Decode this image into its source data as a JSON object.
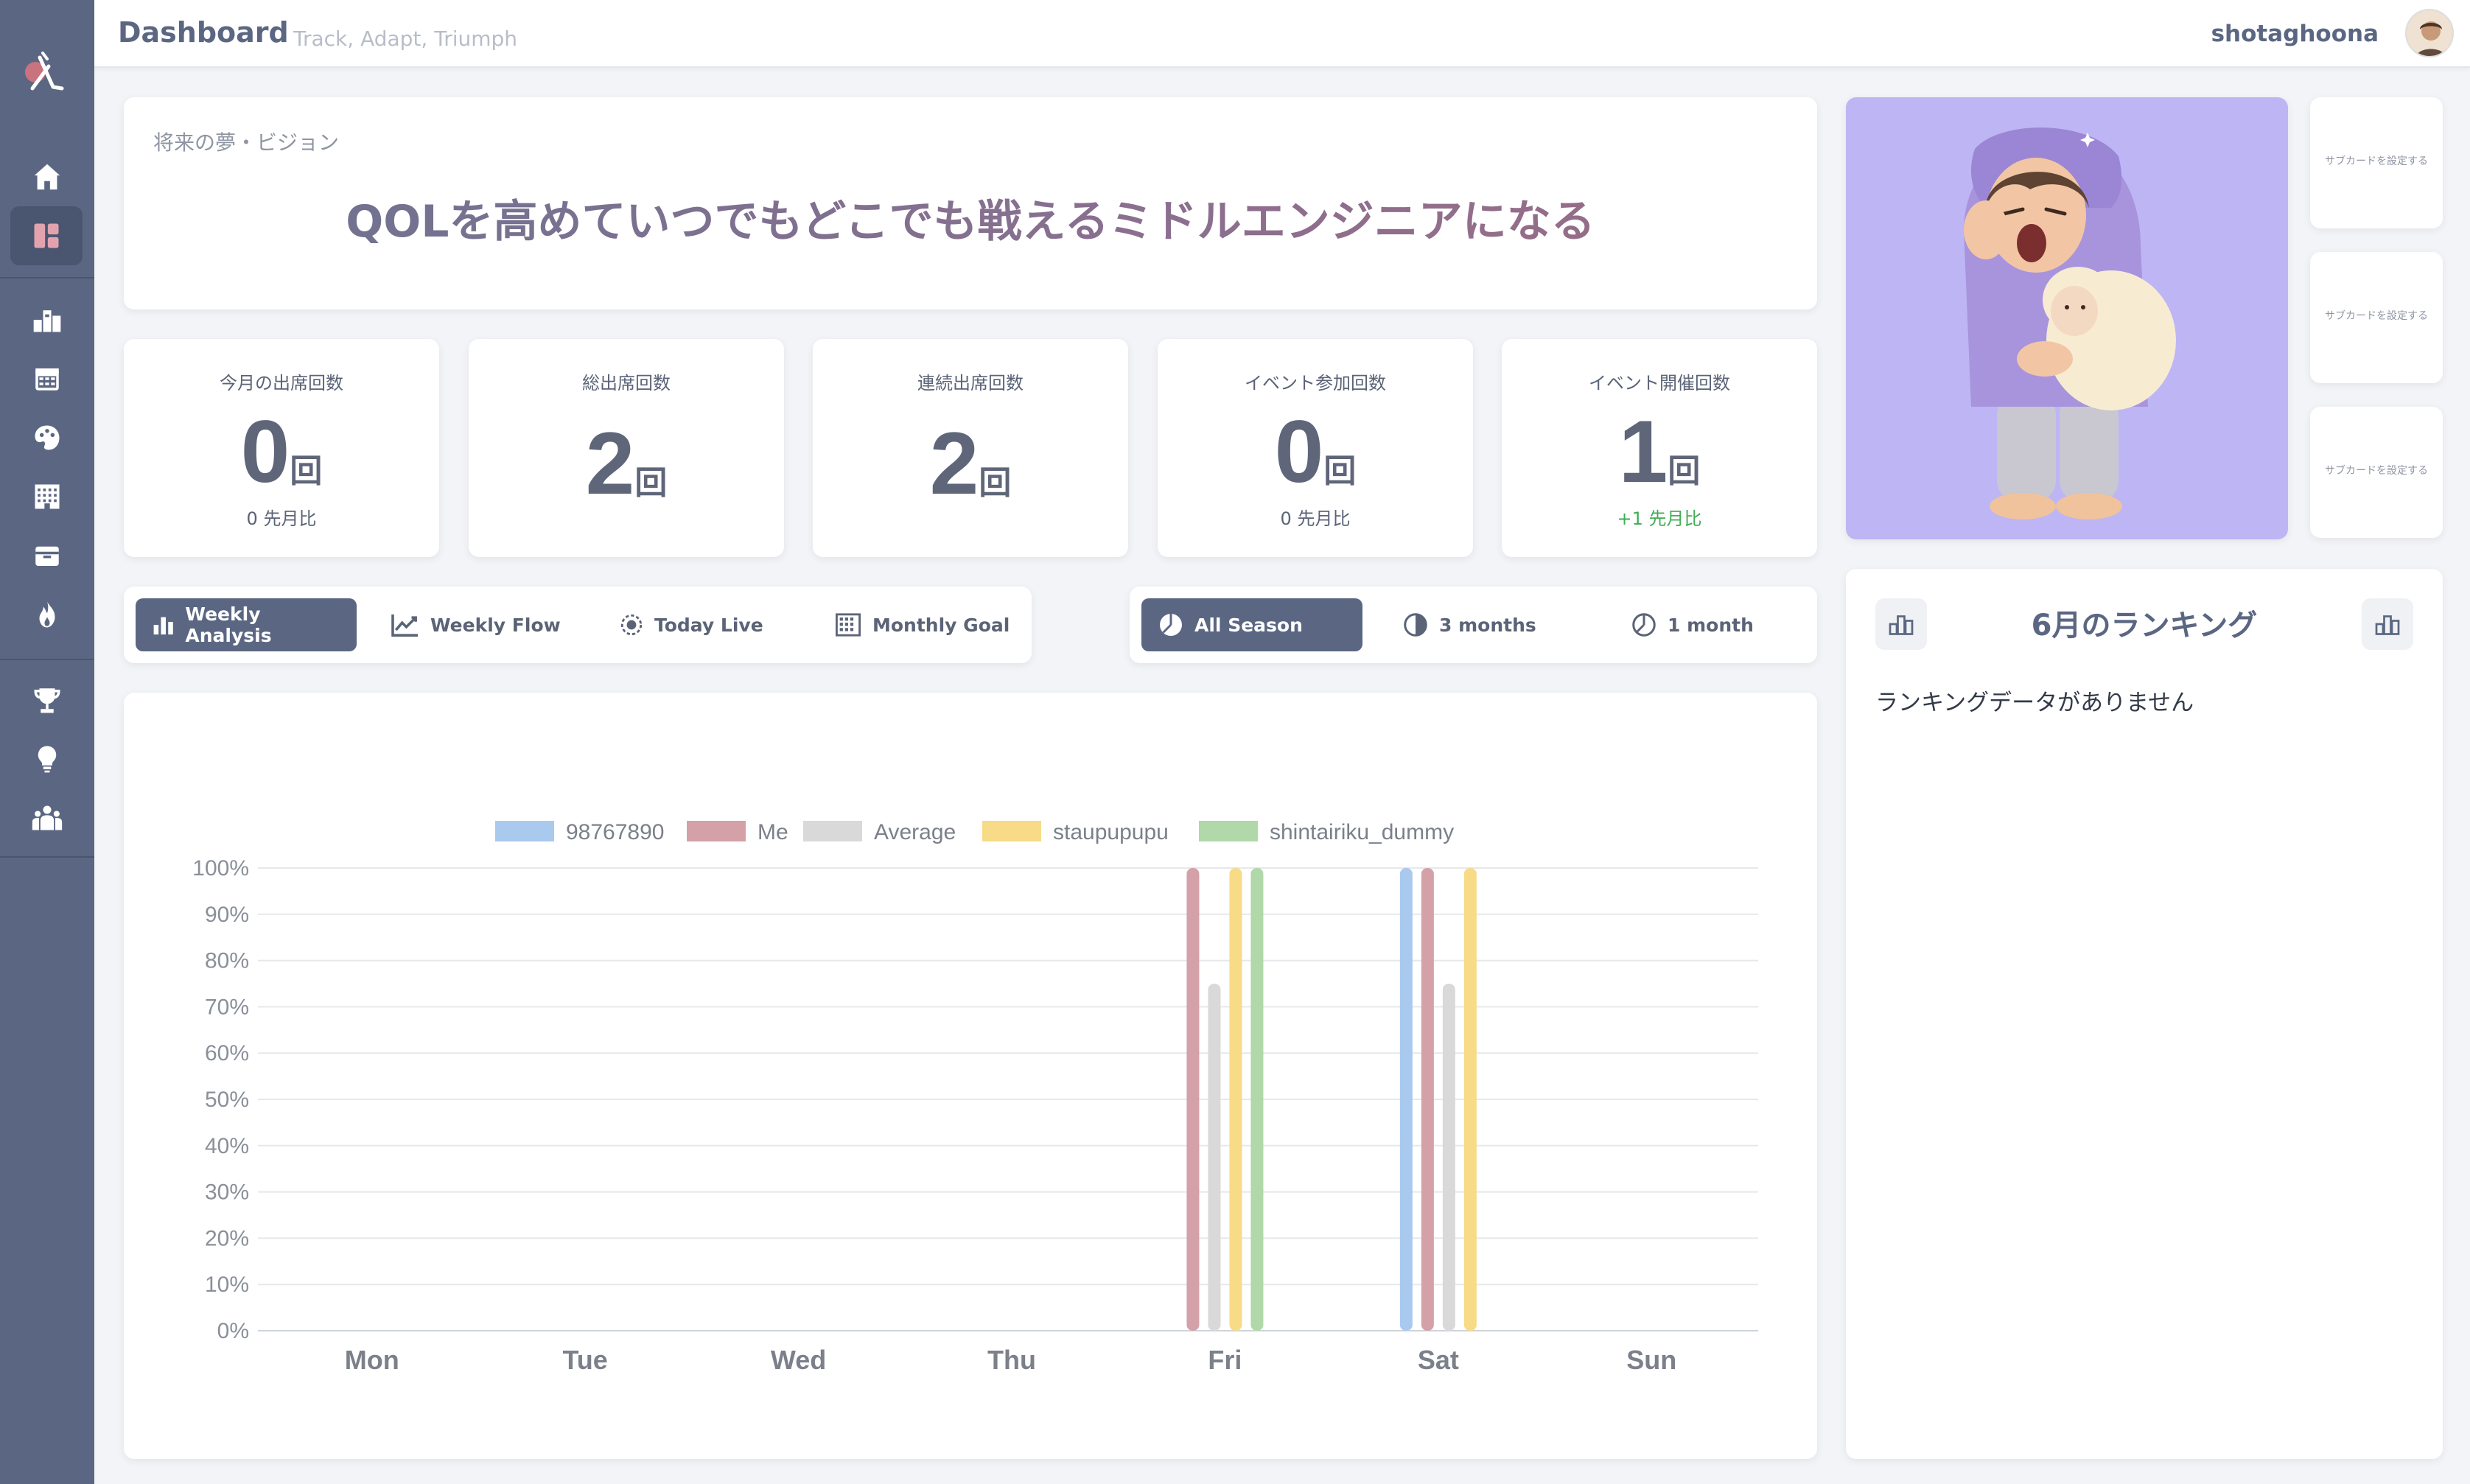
{
  "header": {
    "title": "Dashboard",
    "subtitle": "Track, Adapt, Triumph",
    "username": "shotaghoona"
  },
  "sidebar": {
    "items": [
      {
        "icon": "home-icon"
      },
      {
        "icon": "dashboard-icon",
        "active": true
      },
      {
        "icon": "ranking-icon"
      },
      {
        "icon": "calendar-icon"
      },
      {
        "icon": "palette-icon"
      },
      {
        "icon": "building-icon"
      },
      {
        "icon": "archive-icon"
      },
      {
        "icon": "fire-icon"
      },
      {
        "icon": "trophy-icon"
      },
      {
        "icon": "lightbulb-icon"
      },
      {
        "icon": "team-icon"
      }
    ]
  },
  "vision": {
    "label": "将来の夢・ビジョン",
    "text": "QOLを高めていつでもどこでも戦えるミドルエンジニアになる"
  },
  "stats": [
    {
      "title": "今月の出席回数",
      "value": "0",
      "unit": "回",
      "diff": "0 先月比"
    },
    {
      "title": "総出席回数",
      "value": "2",
      "unit": "回",
      "diff": ""
    },
    {
      "title": "連続出席回数",
      "value": "2",
      "unit": "回",
      "diff": ""
    },
    {
      "title": "イベント参加回数",
      "value": "0",
      "unit": "回",
      "diff": "0 先月比"
    },
    {
      "title": "イベント開催回数",
      "value": "1",
      "unit": "回",
      "diff": "+1 先月比"
    }
  ],
  "view_tabs": [
    {
      "label": "Weekly Analysis",
      "icon": "bar-chart-icon",
      "active": true
    },
    {
      "label": "Weekly Flow",
      "icon": "line-chart-icon",
      "active": false
    },
    {
      "label": "Today Live",
      "icon": "live-icon",
      "active": false
    },
    {
      "label": "Monthly Goal",
      "icon": "grid-icon",
      "active": false
    }
  ],
  "range_tabs": [
    {
      "label": "All Season",
      "icon": "pie-full-icon",
      "active": true
    },
    {
      "label": "3 months",
      "icon": "pie-half-icon",
      "active": false
    },
    {
      "label": "1 month",
      "icon": "pie-quarter-icon",
      "active": false
    }
  ],
  "ranking": {
    "title": "6月のランキング",
    "empty": "ランキングデータがありません"
  },
  "subcards": [
    "サブカードを設定する",
    "サブカードを設定する",
    "サブカードを設定する"
  ],
  "chart_data": {
    "type": "bar",
    "categories": [
      "Mon",
      "Tue",
      "Wed",
      "Thu",
      "Fri",
      "Sat",
      "Sun"
    ],
    "ylim": [
      0,
      100
    ],
    "yticks": [
      "0%",
      "10%",
      "20%",
      "30%",
      "40%",
      "50%",
      "60%",
      "70%",
      "80%",
      "90%",
      "100%"
    ],
    "grid": true,
    "legend": "top",
    "series": [
      {
        "name": "98767890",
        "color": "#a9c9ef",
        "values": [
          0,
          0,
          0,
          0,
          0,
          100,
          0
        ]
      },
      {
        "name": "Me",
        "color": "#d4a1a8",
        "values": [
          0,
          0,
          0,
          0,
          100,
          100,
          0
        ]
      },
      {
        "name": "Average",
        "color": "#d9d9d9",
        "values": [
          0,
          0,
          0,
          0,
          75,
          75,
          0
        ]
      },
      {
        "name": "staupupupu",
        "color": "#f7db86",
        "values": [
          0,
          0,
          0,
          0,
          100,
          100,
          0
        ]
      },
      {
        "name": "shintairiku_dummy",
        "color": "#b0d8a8",
        "values": [
          0,
          0,
          0,
          0,
          100,
          0,
          0
        ]
      }
    ]
  }
}
